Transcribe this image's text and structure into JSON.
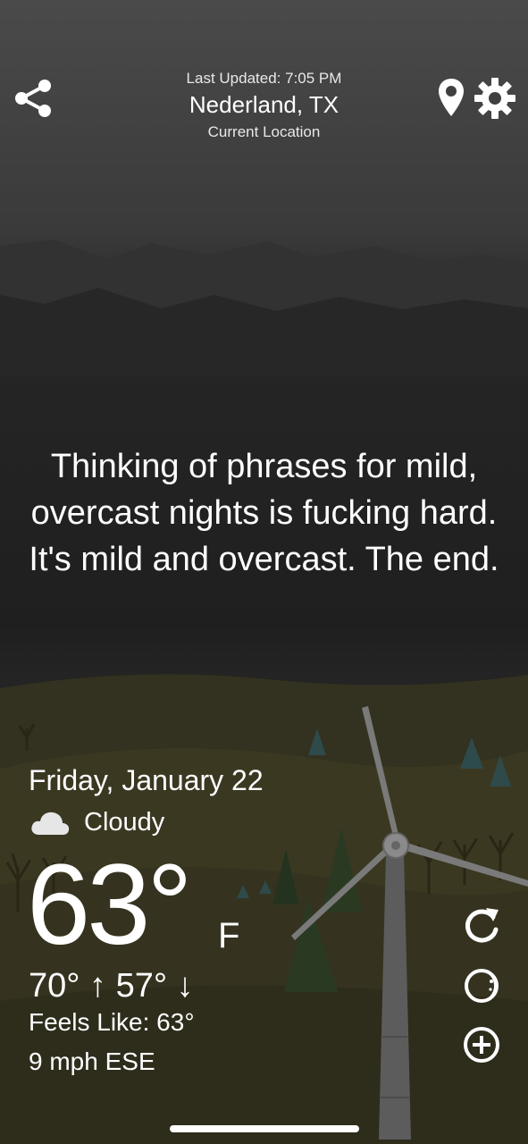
{
  "header": {
    "last_updated": "Last Updated: 7:05 PM",
    "city": "Nederland, TX",
    "location_label": "Current Location"
  },
  "icons": {
    "share": "share-icon",
    "location": "location-pin-icon",
    "settings": "gear-icon",
    "condition": "cloud-icon",
    "refresh": "refresh-icon",
    "moon": "moon-icon",
    "add": "add-circle-icon"
  },
  "phrase": "Thinking of phrases for mild, overcast nights is fucking hard. It's mild and overcast. The end.",
  "weather": {
    "date": "Friday, January 22",
    "condition": "Cloudy",
    "temperature": "63°",
    "unit": "F",
    "hilo": "70° ↑  57° ↓",
    "feels_like": "Feels Like: 63°",
    "wind": "9 mph ESE"
  },
  "colors": {
    "sky_top": "#4a4a4a",
    "sky_night": "#1f1f1f",
    "ground": "#3a3621",
    "text": "#ffffff"
  }
}
